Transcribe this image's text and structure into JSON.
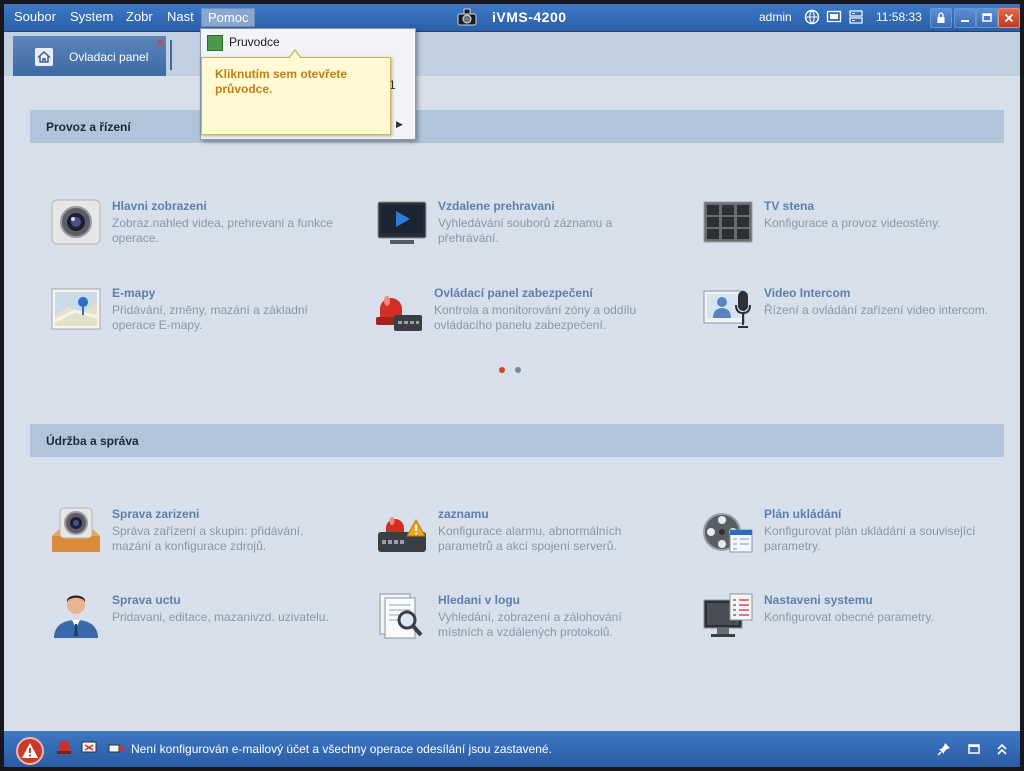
{
  "menubar": {
    "items": [
      "Soubor",
      "System",
      "Zobr",
      "Nast",
      "Pomoc"
    ],
    "active": "Pomoc"
  },
  "app": {
    "title": "iVMS-4200",
    "user": "admin",
    "clock": "11:58:33"
  },
  "tab": {
    "label": "Ovladaci panel"
  },
  "help_menu": {
    "items": [
      {
        "label": "Pruvodce",
        "icon": "wizard-icon"
      }
    ],
    "tooltip": "Kliknutím sem otevřete průvodce.",
    "partial_char": "1"
  },
  "sections": [
    {
      "title": "Provoz a řízení",
      "modules": [
        {
          "title": "Hlavni zobrazeni",
          "desc": "Zobraz.nahled videa, prehrevani a funkce operace.",
          "icon": "camera-icon"
        },
        {
          "title": "Vzdalene prehravani",
          "desc": "Vyhledávání souborů záznamu a přehrávání.",
          "icon": "playback-icon"
        },
        {
          "title": "TV stena",
          "desc": "Konfigurace a provoz videostěny.",
          "icon": "video-wall-icon"
        },
        {
          "title": "E-mapy",
          "desc": "Přidávání, změny, mazání a základní operace E-mapy.",
          "icon": "emap-icon"
        },
        {
          "title": "Ovládací panel zabezpečení",
          "desc": "Kontrola a monitorování zóny a oddílu ovládacího panelu zabezpečení.",
          "icon": "alarm-panel-icon"
        },
        {
          "title": "Video Intercom",
          "desc": "Řízení a ovládání zařízení video intercom.",
          "icon": "intercom-icon"
        }
      ]
    },
    {
      "title": "Údržba a správa",
      "modules": [
        {
          "title": "Sprava zarizeni",
          "desc": "Správa zařízení a skupin: přidávání, mazání a konfigurace zdrojů.",
          "icon": "device-management-icon"
        },
        {
          "title": "zaznamu",
          "desc": "Konfigurace alarmu, abnormálních parametrů a akcí spojení serverů.",
          "icon": "event-config-icon"
        },
        {
          "title": "Plán ukládání",
          "desc": "Konfigurovat plán ukládání a související parametry.",
          "icon": "storage-schedule-icon"
        },
        {
          "title": "Sprava uctu",
          "desc": "Pridavani, editace, mazanivzd. uzivatelu.",
          "icon": "account-icon"
        },
        {
          "title": "Hledani v logu",
          "desc": "Vyhledání, zobrazení a zálohování místních a vzdálených protokolů.",
          "icon": "log-search-icon"
        },
        {
          "title": "Nastaveni systemu",
          "desc": "Konfigurovat obecné parametry.",
          "icon": "system-config-icon"
        }
      ]
    }
  ],
  "pager": {
    "pages": 2,
    "current": 1,
    "active_color": "#d8402e",
    "inactive_color": "#7a8696"
  },
  "status": {
    "text": "Není konfigurován e-mailový účet a všechny operace odesílání jsou zastavené."
  },
  "colors": {
    "titlebar": "#2b5fa7",
    "background": "#d6dfea",
    "module_title": "#5e7fae",
    "tooltip_text": "#c27d17"
  }
}
